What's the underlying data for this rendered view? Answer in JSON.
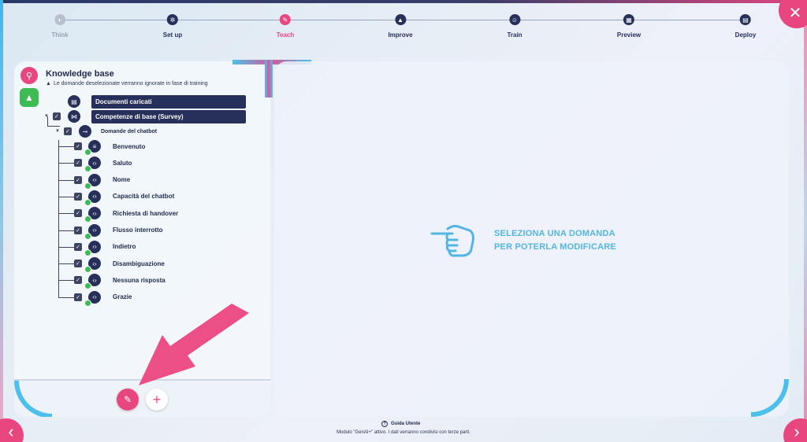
{
  "stepper": {
    "steps": [
      {
        "label": "Think",
        "icon": "brain-icon"
      },
      {
        "label": "Set up",
        "icon": "gear-icon"
      },
      {
        "label": "Teach",
        "icon": "pencil-icon"
      },
      {
        "label": "Improve",
        "icon": "graph-icon"
      },
      {
        "label": "Train",
        "icon": "bot-icon"
      },
      {
        "label": "Preview",
        "icon": "calendar-icon"
      },
      {
        "label": "Deploy",
        "icon": "rocket-icon"
      }
    ],
    "active": "Teach"
  },
  "knowledge_base": {
    "title": "Knowledge base",
    "note": "Le domande deselezionate verranno ignorate in fase di training",
    "items": {
      "documenti": "Documenti caricati",
      "competenze": "Competenze di base (Survey)",
      "domande": "Domande del chatbot"
    },
    "questions": [
      "Benvenuto",
      "Saluto",
      "Nome",
      "Capacità del chatbot",
      "Richiesta di handover",
      "Flusso interrotto",
      "Indietro",
      "Disambiguazione",
      "Nessuna risposta",
      "Grazie"
    ]
  },
  "main": {
    "message_line1": "SELEZIONA UNA DOMANDA",
    "message_line2": "PER POTERLA MODIFICARE"
  },
  "footer": {
    "guide": "Guida Utente",
    "notice": "Modulo \"GenAI+\" attivo. I dati verranno condivisi con terze parti."
  },
  "colors": {
    "accent": "#e8467f",
    "navy": "#26305a",
    "cyan": "#4cc0ea",
    "green": "#3fbb56"
  }
}
